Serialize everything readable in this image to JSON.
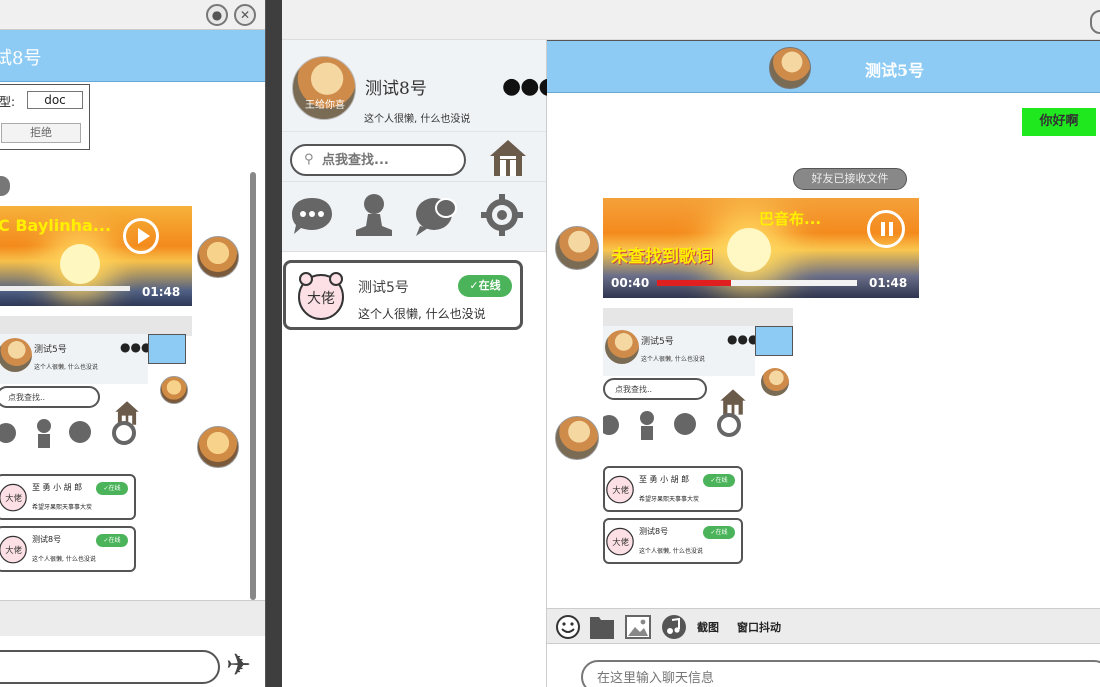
{
  "left_window": {
    "header_title": "试8号",
    "file_prompt_label": "型:",
    "file_type": "doc",
    "refuse_label": "拒绝",
    "song_title": "C Baylinha...",
    "song_duration": "01:48",
    "send_icon": "airplane-icon"
  },
  "profile": {
    "name": "测试8号",
    "signature": "这个人很懒, 什么也没说",
    "avatar_caption": "王给你喜",
    "more_label": "●●●"
  },
  "search": {
    "placeholder": "点我查找...",
    "icon": "home-icon"
  },
  "nav": [
    "chat-bubble-icon",
    "contacts-icon",
    "group-chat-icon",
    "settings-icon"
  ],
  "friends": [
    {
      "name": "测试5号",
      "signature": "这个人很懒, 什么也没说",
      "status": "✓在线"
    }
  ],
  "chat": {
    "title": "测试5号",
    "sent_message": "你好啊",
    "system_notice": "好友已接收文件",
    "music": {
      "title": "巴音布...",
      "lyric": "未查找到歌词",
      "current_time": "00:40",
      "duration": "01:48",
      "progress": 0.37
    },
    "toolbar": {
      "screenshot_label": "截图",
      "shake_label": "窗口抖动"
    },
    "input_placeholder": "在这里输入聊天信息"
  },
  "mini_screens": {
    "name": "测试5号",
    "sig": "这个人很懒, 什么也没说",
    "search": "点我查找..",
    "cards": [
      {
        "name": "至 勇 小 胡 郎",
        "sig": "希望牙果熙天事事大炭",
        "status": "✓在线"
      },
      {
        "name": "测试8号",
        "sig": "这个人很懒, 什么也没说",
        "status": "✓在线"
      }
    ],
    "more_label": "●●●"
  },
  "colors": {
    "header_blue": "#8dcbf5",
    "online_green": "#4bb45a",
    "message_green": "#1fe81f",
    "progress_red": "#e02020"
  }
}
